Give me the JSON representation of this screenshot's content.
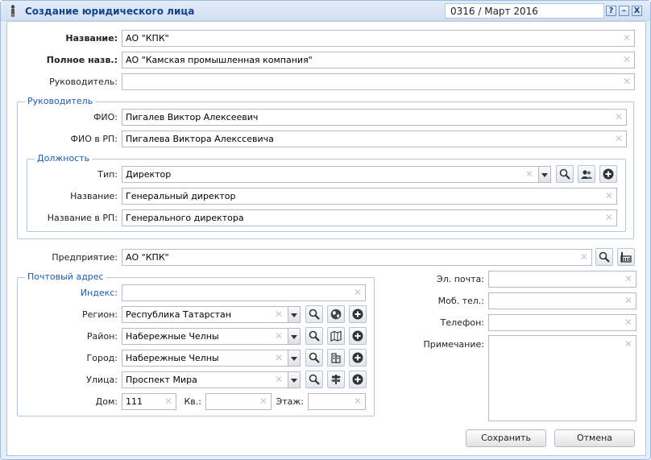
{
  "window": {
    "title": "Создание юридического лица",
    "info": "0316 / Март 2016",
    "help_label": "?",
    "minimize_label": "–",
    "close_label": "X"
  },
  "org": {
    "name_label": "Название:",
    "name_value": "АО \"КПК\"",
    "fullname_label": "Полное назв.:",
    "fullname_value": "АО \"Камская промышленная компания\"",
    "head_label": "Руководитель:",
    "head_value": ""
  },
  "head": {
    "legend": "Руководитель",
    "fio_label": "ФИО:",
    "fio_value": "Пигалев Виктор Алексеевич",
    "fio_rp_label": "ФИО в РП:",
    "fio_rp_value": "Пигалева Виктора Алекссевича"
  },
  "position": {
    "legend": "Должность",
    "type_label": "Тип:",
    "type_value": "Директор",
    "name_label": "Название:",
    "name_value": "Генеральный директор",
    "name_rp_label": "Название в РП:",
    "name_rp_value": "Генерального директора"
  },
  "enterprise": {
    "label": "Предприятие:",
    "value": "АО \"КПК\""
  },
  "address": {
    "legend": "Почтовый адрес",
    "index_label": "Индекс:",
    "index_value": "",
    "region_label": "Регион:",
    "region_value": "Республика Татарстан",
    "district_label": "Район:",
    "district_value": "Набережные Челны",
    "city_label": "Город:",
    "city_value": "Набережные Челны",
    "street_label": "Улица:",
    "street_value": "Проспект Мира",
    "house_label": "Дом:",
    "house_value": "111",
    "apt_label": "Кв.:",
    "apt_value": "",
    "floor_label": "Этаж:",
    "floor_value": ""
  },
  "contacts": {
    "email_label": "Эл. почта:",
    "email_value": "",
    "mobile_label": "Моб. тел.:",
    "mobile_value": "",
    "phone_label": "Телефон:",
    "phone_value": "",
    "note_label": "Примечание:",
    "note_value": ""
  },
  "buttons": {
    "save": "Сохранить",
    "cancel": "Отмена"
  }
}
